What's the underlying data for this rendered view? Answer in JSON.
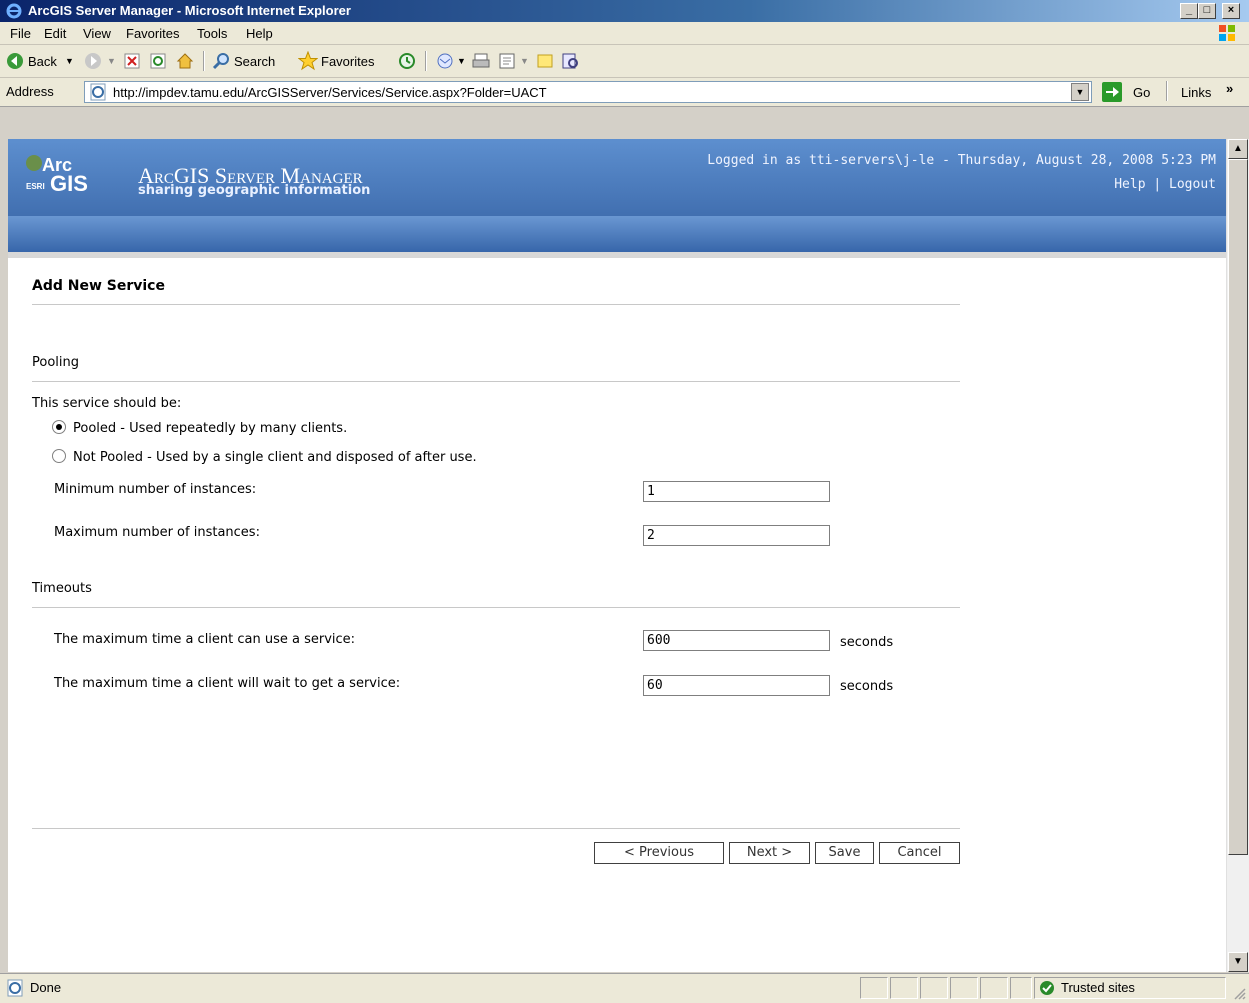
{
  "window": {
    "title": "ArcGIS Server Manager - Microsoft Internet Explorer",
    "buttons": [
      "_",
      "□",
      "×"
    ]
  },
  "menu": [
    "File",
    "Edit",
    "View",
    "Favorites",
    "Tools",
    "Help"
  ],
  "toolbar": {
    "back": "Back",
    "search": "Search",
    "favorites": "Favorites"
  },
  "address": {
    "label": "Address",
    "url": "http://impdev.tamu.edu/ArcGISServer/Services/Service.aspx?Folder=UACT",
    "go": "Go",
    "links": "Links"
  },
  "banner": {
    "logo_arc": "Arc",
    "logo_gis": "GIS",
    "logo_esri": "ESRI",
    "app_title": "ArcGIS Server Manager",
    "tagline": "sharing geographic information",
    "login": "Logged in as tti-servers\\j-le - Thursday, August 28, 2008 5:23 PM",
    "help": "Help",
    "separator": "|",
    "logout": "Logout"
  },
  "page": {
    "title": "Add New Service",
    "pooling_section": "Pooling",
    "should_be": "This service should be:",
    "pooled": {
      "label": "Pooled - Used repeatedly by many clients.",
      "selected": true
    },
    "not_pooled": {
      "label": "Not Pooled - Used by a single client and disposed of after use.",
      "selected": false
    },
    "min_label": "Minimum number of instances:",
    "min_value": "1",
    "max_label": "Maximum number of instances:",
    "max_value": "2",
    "timeouts_section": "Timeouts",
    "use_label": "The maximum time a client can use a service:",
    "use_value": "600",
    "wait_label": "The maximum time a client will wait to get a service:",
    "wait_value": "60",
    "unit": "seconds",
    "buttons": {
      "previous": "< Previous",
      "next": "Next >",
      "save": "Save",
      "cancel": "Cancel"
    }
  },
  "status": {
    "text": "Done",
    "zone": "Trusted sites"
  }
}
